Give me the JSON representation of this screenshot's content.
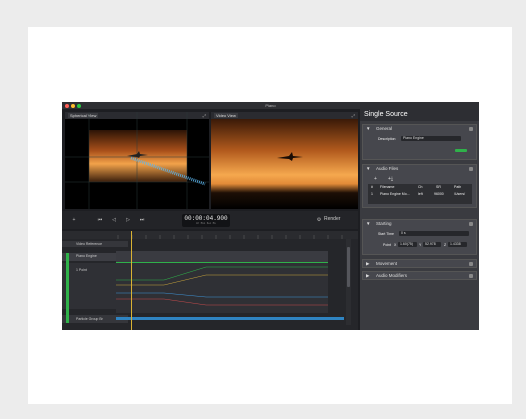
{
  "window": {
    "title": "Piano"
  },
  "viewports": {
    "spherical_label": "Spherical View",
    "video_label": "Video View"
  },
  "toolbar": {
    "add": "+",
    "timecode": "00:00:04.900",
    "timecode_units": "Hr  Min  Sec  Ms",
    "render_label": "Render"
  },
  "timeline": {
    "tracks": [
      "Video Reference",
      "Piano Engine",
      "1 Point",
      "Particle Group Br"
    ]
  },
  "sidebar": {
    "title": "Single Source",
    "general": {
      "title": "General",
      "description_label": "Description",
      "description_value": "Piano Engine"
    },
    "audio_files": {
      "title": "Audio Files",
      "headers": [
        "#",
        "Filename",
        "Ch",
        "SR",
        "Path"
      ],
      "row": [
        "1",
        "Piano Engine Mo...",
        "left",
        "96000",
        "/Users/"
      ]
    },
    "starting": {
      "title": "Starting",
      "start_time_label": "Start Time",
      "start_time_value": "0 s",
      "point_label": "Point",
      "x_label": "X",
      "x_value": "1.60(75)",
      "y_label": "Y",
      "y_value": "52.978",
      "z_label": "Z",
      "z_value": "1.4338"
    },
    "movement": {
      "title": "Movement"
    },
    "audio_modifiers": {
      "title": "Audio Modifiers"
    }
  },
  "colors": {
    "accent_green": "#2fb14a",
    "timeline_blue": "#2f84c2",
    "playhead": "#d9b233"
  }
}
